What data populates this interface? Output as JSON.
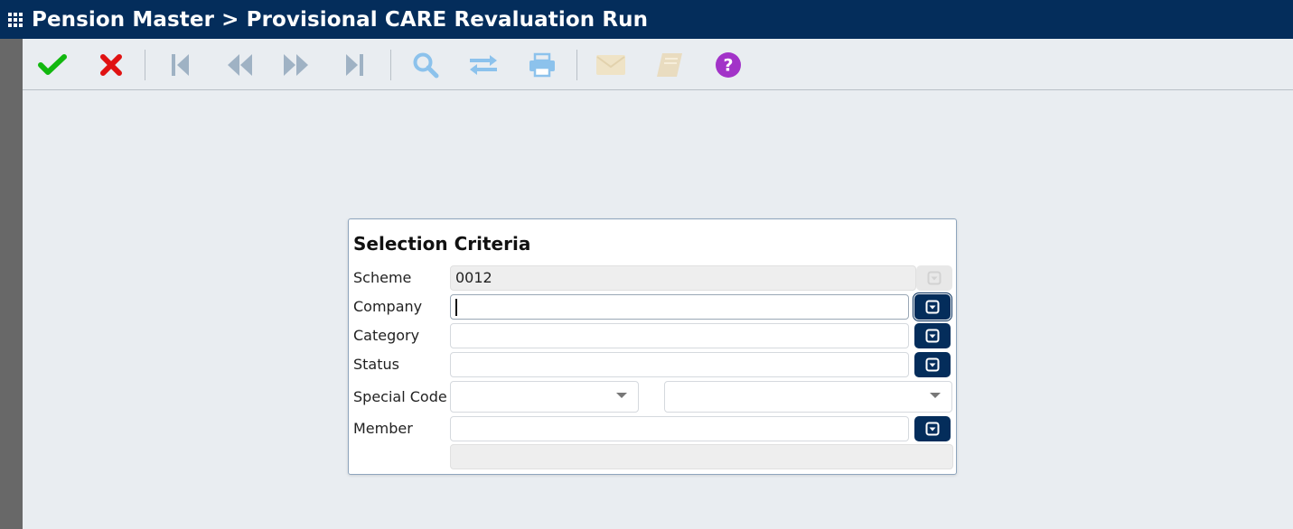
{
  "window": {
    "title": "Pension Master > Provisional CARE Revaluation Run"
  },
  "toolbar": {
    "buttons": [
      {
        "name": "accept",
        "icon": "checkmark-icon",
        "color": "#12b80f",
        "enabled": true
      },
      {
        "name": "cancel",
        "icon": "x-icon",
        "color": "#e01212",
        "enabled": true
      },
      {
        "name": "first",
        "icon": "skip-first-icon",
        "color": "#9fb2c4",
        "enabled": false
      },
      {
        "name": "previous",
        "icon": "rewind-icon",
        "color": "#9fb2c4",
        "enabled": false
      },
      {
        "name": "next",
        "icon": "fast-forward-icon",
        "color": "#9fb2c4",
        "enabled": false
      },
      {
        "name": "last",
        "icon": "skip-last-icon",
        "color": "#9fb2c4",
        "enabled": false
      },
      {
        "name": "search",
        "icon": "magnifier-icon",
        "color": "#8cc2ec",
        "enabled": false
      },
      {
        "name": "swap",
        "icon": "swap-arrows-icon",
        "color": "#8cc2ec",
        "enabled": false
      },
      {
        "name": "print",
        "icon": "printer-icon",
        "color": "#8cc2ec",
        "enabled": false
      },
      {
        "name": "email",
        "icon": "envelope-icon",
        "color": "#efe3c6",
        "enabled": false
      },
      {
        "name": "notes",
        "icon": "notebook-icon",
        "color": "#e9dcc0",
        "enabled": false
      },
      {
        "name": "help",
        "icon": "question-circle-icon",
        "color": "#a233c8",
        "enabled": true
      }
    ]
  },
  "form": {
    "title": "Selection Criteria",
    "scheme": {
      "label": "Scheme",
      "value": "0012"
    },
    "company": {
      "label": "Company",
      "value": ""
    },
    "category": {
      "label": "Category",
      "value": ""
    },
    "status": {
      "label": "Status",
      "value": ""
    },
    "special_code": {
      "label": "Special Code",
      "value1": "",
      "value2": ""
    },
    "member": {
      "label": "Member",
      "value": "",
      "name": ""
    }
  },
  "colors": {
    "header": "#042d5b",
    "background": "#e9edf1",
    "lookup_button": "#042d5b"
  }
}
